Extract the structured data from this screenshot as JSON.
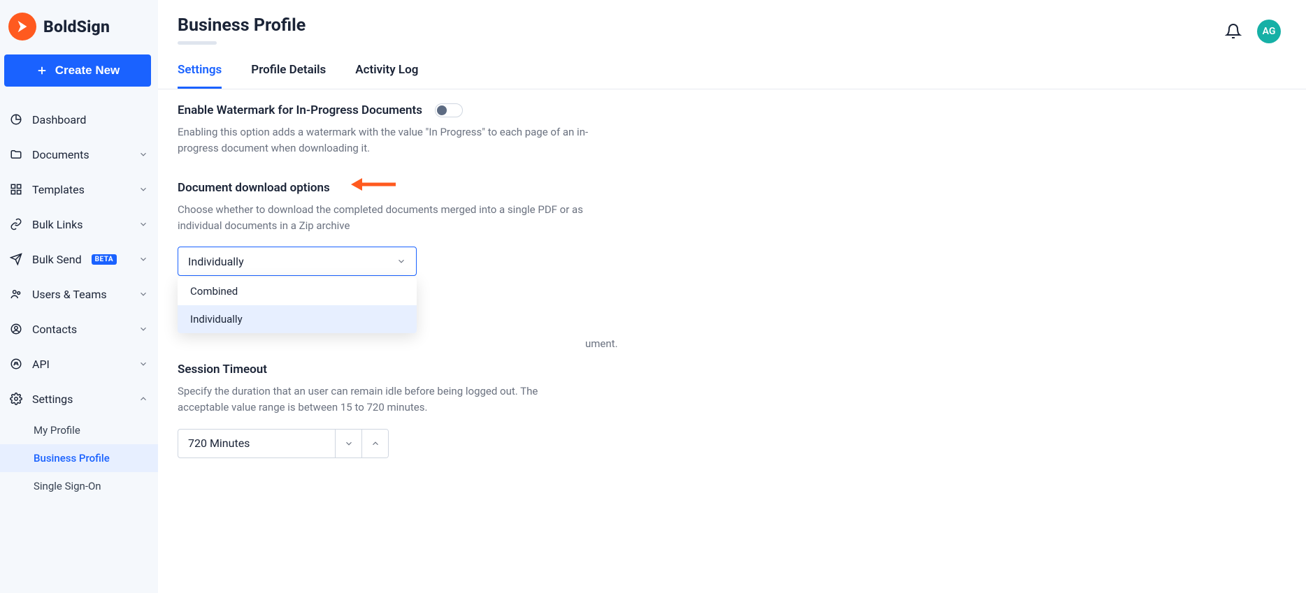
{
  "brand": {
    "name": "BoldSign"
  },
  "create_button": "Create New",
  "nav": {
    "dashboard": "Dashboard",
    "documents": "Documents",
    "templates": "Templates",
    "bulk_links": "Bulk Links",
    "bulk_send": "Bulk Send",
    "bulk_send_badge": "BETA",
    "users_teams": "Users & Teams",
    "contacts": "Contacts",
    "api": "API",
    "settings": "Settings",
    "sub": {
      "my_profile": "My Profile",
      "business_profile": "Business Profile",
      "sso": "Single Sign-On"
    }
  },
  "header": {
    "title": "Business Profile",
    "tabs": {
      "settings": "Settings",
      "profile_details": "Profile Details",
      "activity_log": "Activity Log"
    },
    "avatar_initials": "AG"
  },
  "sections": {
    "watermark": {
      "title": "Enable Watermark for In-Progress Documents",
      "desc": "Enabling this option adds a watermark with the value \"In Progress\" to each page of an in-progress document when downloading it."
    },
    "download": {
      "title": "Document download options",
      "desc": "Choose whether to download the completed documents merged into a single PDF or as individual documents in a Zip archive",
      "selected": "Individually",
      "options": {
        "combined": "Combined",
        "individually": "Individually"
      }
    },
    "hidden_peek": "ument.",
    "session": {
      "title": "Session Timeout",
      "desc": "Specify the duration that an user can remain idle before being logged out. The acceptable value range is between 15 to 720 minutes.",
      "value": "720 Minutes"
    }
  }
}
